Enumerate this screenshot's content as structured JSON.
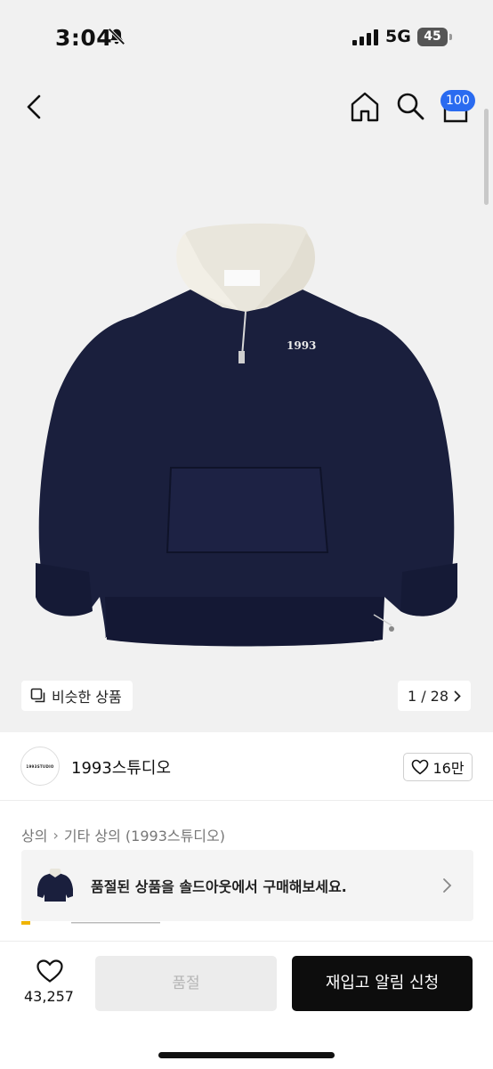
{
  "status_bar": {
    "time": "3:04",
    "network": "5G",
    "battery": "45",
    "icons": [
      "bell-muted-icon",
      "signal-icon"
    ]
  },
  "nav": {
    "icons": [
      "back-icon",
      "home-icon",
      "search-icon",
      "cart-icon"
    ],
    "cart_badge": "100"
  },
  "gallery": {
    "similar_label": "비슷한 상품",
    "counter": "1 / 28"
  },
  "seller": {
    "name": "1993스튜디오",
    "logo_text": "1993STUDIO",
    "like_count": "16만"
  },
  "breadcrumb": {
    "category": "상의",
    "subcategory": "기타 상의 (1993스튜디오)"
  },
  "soldout_banner": {
    "text": "품절된 상품을 솔드아웃에서 구매해보세요."
  },
  "bottom_bar": {
    "wish_count": "43,257",
    "soldout_label": "품절",
    "restock_label": "재입고 알림 신청"
  },
  "colors": {
    "accent_badge": "#2a6bf0",
    "primary_button": "#0d0d0d",
    "disabled_button": "#ececec",
    "background": "#f1f1f1"
  }
}
